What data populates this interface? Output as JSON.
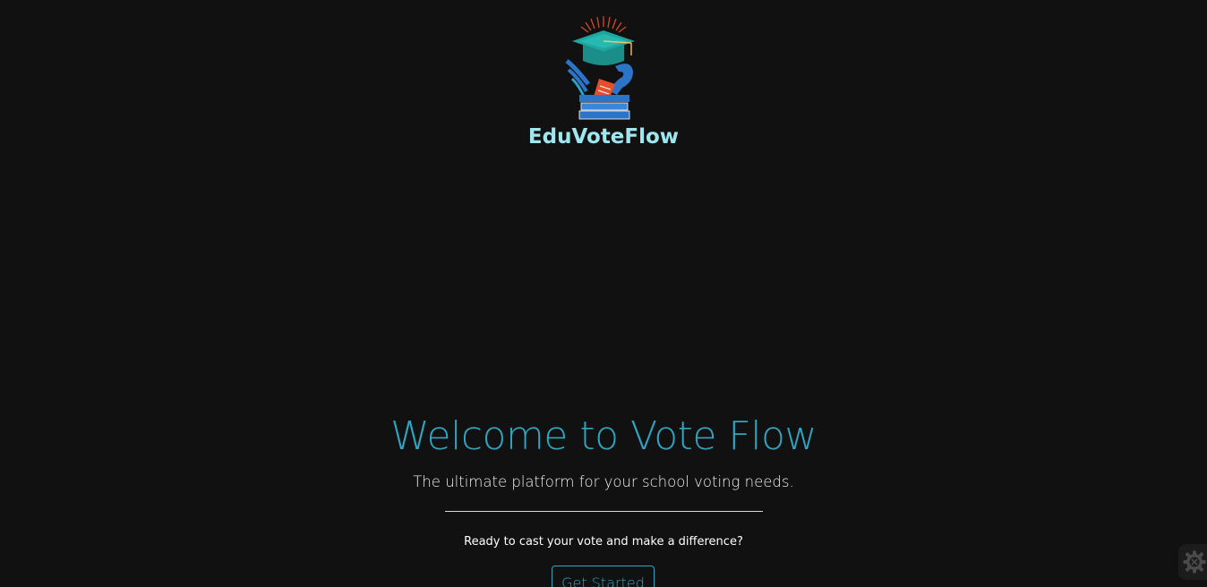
{
  "brand": {
    "name": "EduVoteFlow",
    "logo_icon": "graduation-cap-ballot-box-icon"
  },
  "hero": {
    "title": "Welcome to Vote Flow",
    "subtitle": "The ultimate platform for your school voting needs.",
    "cta_text": "Ready to cast your vote and make a difference?",
    "button_label": "Get Started"
  },
  "floating_widget": {
    "icon": "gear-settings-icon"
  },
  "colors": {
    "background": "#111111",
    "accent": "#2fa5c1",
    "brand_text": "#9fe6ee",
    "logo_teal": "#1fa5a0",
    "logo_blue": "#2c74c8",
    "logo_orange": "#e84e2c"
  }
}
